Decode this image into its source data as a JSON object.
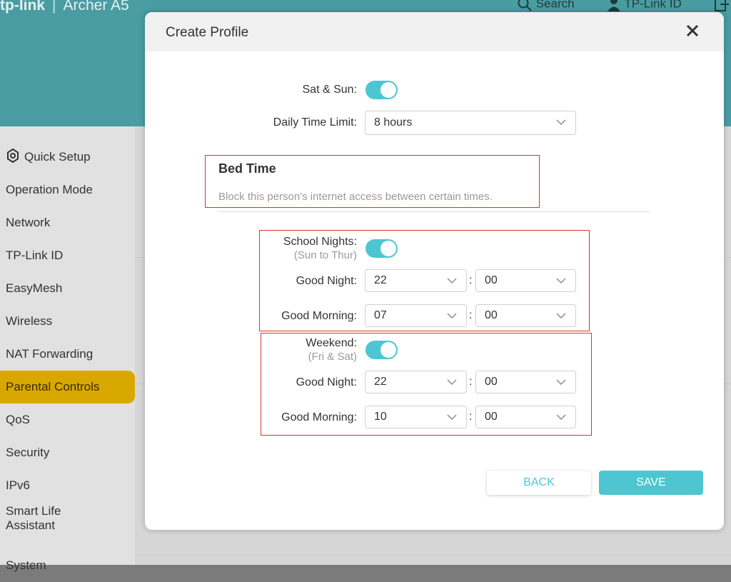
{
  "header": {
    "brand": "tp-link",
    "product": "Archer A5",
    "search_label": "Search",
    "account_label": "TP-Link ID"
  },
  "sidebar": {
    "items": [
      {
        "label": "Quick Setup"
      },
      {
        "label": "Operation Mode"
      },
      {
        "label": "Network"
      },
      {
        "label": "TP-Link ID"
      },
      {
        "label": "EasyMesh"
      },
      {
        "label": "Wireless"
      },
      {
        "label": "NAT Forwarding"
      },
      {
        "label": "Parental Controls",
        "active": true
      },
      {
        "label": "QoS"
      },
      {
        "label": "Security"
      },
      {
        "label": "IPv6"
      },
      {
        "label_line1": "Smart Life",
        "label_line2": "Assistant"
      },
      {
        "label": "System"
      }
    ]
  },
  "modal": {
    "title": "Create Profile",
    "sat_sun": {
      "label": "Sat & Sun:",
      "enabled": true
    },
    "daily_limit": {
      "label": "Daily Time Limit:",
      "value": "8 hours"
    },
    "bed_time": {
      "title": "Bed Time",
      "description": "Block this person's internet access between certain times."
    },
    "school_nights": {
      "label": "School Nights:",
      "sublabel": "(Sun to Thur)",
      "enabled": true,
      "good_night_label": "Good Night:",
      "good_night_hour": "22",
      "good_night_min": "00",
      "good_morning_label": "Good Morning:",
      "good_morning_hour": "07",
      "good_morning_min": "00"
    },
    "weekend": {
      "label": "Weekend:",
      "sublabel": "(Fri & Sat)",
      "enabled": true,
      "good_night_label": "Good Night:",
      "good_night_hour": "22",
      "good_night_min": "00",
      "good_morning_label": "Good Morning:",
      "good_morning_hour": "10",
      "good_morning_min": "00"
    },
    "colon": ":",
    "back_label": "BACK",
    "save_label": "SAVE"
  },
  "colors": {
    "header_bg": "#4a9ca3",
    "accent": "#4dc6d2",
    "active_nav": "#d9a800",
    "highlight_box": "#e03030"
  }
}
